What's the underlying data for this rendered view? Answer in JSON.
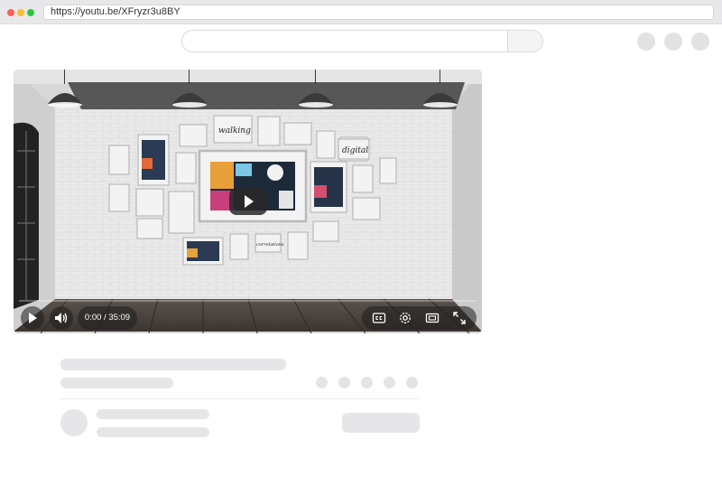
{
  "browser": {
    "url": "https://youtu.be/XFryzr3u8BY"
  },
  "search": {
    "placeholder": "",
    "value": ""
  },
  "video": {
    "time_display": "0:00 / 35:09",
    "progress": 0,
    "scene_words": [
      "walking",
      "digital",
      "correlations"
    ]
  },
  "colors": {
    "accent_red": "#ff5f57",
    "accent_yellow": "#febc2e",
    "accent_green": "#28c840",
    "skeleton": "#e6e6e8"
  }
}
